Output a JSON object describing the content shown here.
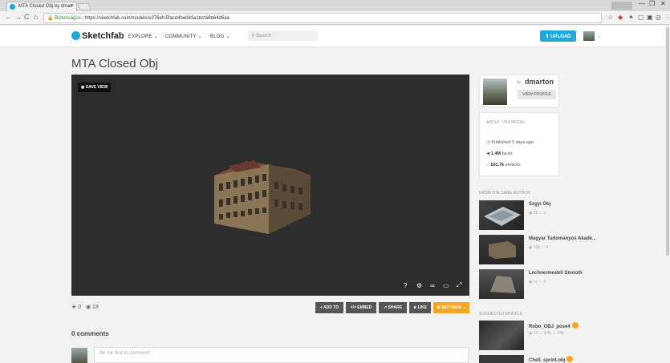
{
  "browser": {
    "tab_title": "MTA Closed Obj by dmar",
    "tab_close": "×",
    "url_secure": "Biztonságos",
    "url": "https://sketchfab.com/models/e376efc5facd4beb83a1bcfa6b64d6aa",
    "nav_back": "←",
    "nav_forward": "→",
    "nav_reload": "C",
    "nav_home": "⌂",
    "minimize": "—",
    "restore": "❐",
    "close": "✕",
    "ext_star": "☆"
  },
  "header": {
    "logo": "Sketchfab",
    "explore": "EXPLORE",
    "community": "COMMUNITY",
    "blog": "BLOG",
    "search_placeholder": "Search",
    "upload": "UPLOAD",
    "caret": "⌄"
  },
  "model": {
    "title": "MTA Closed Obj",
    "save_view": "SAVE VIEW",
    "likes": "0",
    "views": "18",
    "viewer_help": "?",
    "viewer_vr": "▭"
  },
  "actions": {
    "add_to": "+ ADD TO",
    "embed": "</> EMBED",
    "share": "SHARE",
    "like": "LIKE",
    "settings": "SETTINGS"
  },
  "comments": {
    "heading": "0 comments",
    "placeholder": "Be the first to comment!"
  },
  "author": {
    "by": "by",
    "name": "dmarton",
    "view_profile": "VIEW PROFILE"
  },
  "about": {
    "heading": "ABOUT THIS MODEL",
    "published": "Published 5 days ago",
    "faces_value": "1.4M",
    "faces_label": "faces",
    "vertices_value": "691.7k",
    "vertices_label": "vertices"
  },
  "from_author": {
    "heading": "FROM THE SAME AUTHOR",
    "items": [
      {
        "name": "Szgyi Obj",
        "views": "28",
        "likes": "0"
      },
      {
        "name": "Magyar Tudományos Akadé...",
        "views": "106",
        "likes": "0"
      },
      {
        "name": "Lechnermodell Smooth",
        "views": "17",
        "likes": "0"
      }
    ]
  },
  "suggested": {
    "heading": "SUGGESTED MODELS",
    "items": [
      {
        "name": "Robo_OBJ_pose4",
        "views": "13",
        "likes": "9.4k",
        "comments": "246"
      },
      {
        "name": "Chell_sprint.obj",
        "views": "",
        "likes": "",
        "comments": ""
      }
    ]
  },
  "colors": {
    "accent": "#1caad9",
    "settings": "#f5a623"
  }
}
